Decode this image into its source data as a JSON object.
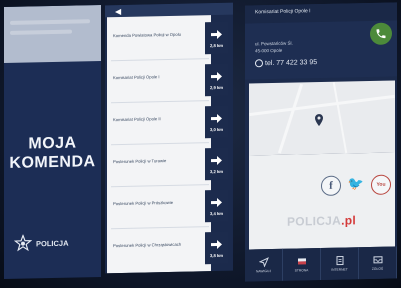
{
  "splash": {
    "title_line1": "MOJA",
    "title_line2": "KOMENDA",
    "logo_text": "POLICJA"
  },
  "list": {
    "items": [
      {
        "label": "Komenda Powiatowa Policji w Opolu",
        "distance": "2,8 km"
      },
      {
        "label": "Komisariat Policji Opole I",
        "distance": "2,9 km"
      },
      {
        "label": "Komisariat Policji Opole II",
        "distance": "3,0 km"
      },
      {
        "label": "Posterunek Policji w Turawie",
        "distance": "3,2 km"
      },
      {
        "label": "Posterunek Policji w Prószkowie",
        "distance": "3,4 km"
      },
      {
        "label": "Posterunek Policji w Chrząstowicach",
        "distance": "3,8 km"
      }
    ]
  },
  "contact": {
    "header": "Komisariat Policji Opole I",
    "address_line1": "ul. Powstańców Śl.",
    "address_line2": "45-000 Opole",
    "phone": "tel. 77 422 33 95",
    "brand": "POLICJA",
    "brand_suffix": ".pl",
    "tabs": [
      "NAWIGUJ",
      "STRONA",
      "INTERNET",
      "ZGŁOŚ"
    ]
  },
  "colors": {
    "navy": "#1c2b4d",
    "call_green": "#4c8a3a",
    "youtube_red": "#b8463f"
  }
}
